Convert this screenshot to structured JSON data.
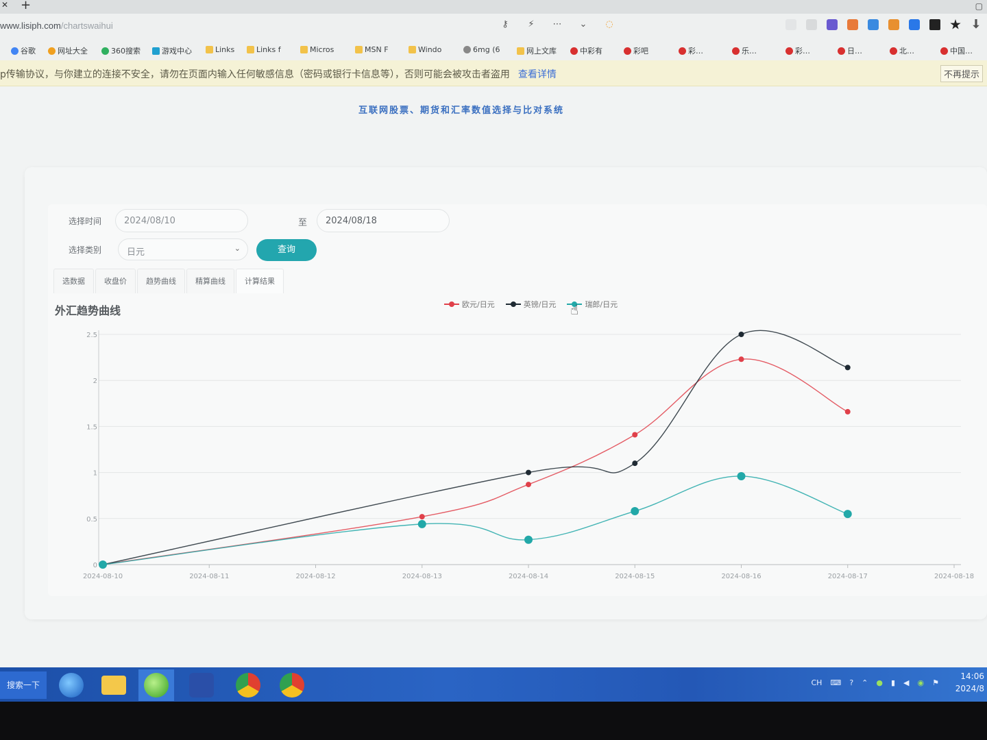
{
  "browser": {
    "url_main": "www.lisiph.com",
    "url_path": "/chartswaihui",
    "bookmarks": [
      "谷歌",
      "网址大全",
      "360搜索",
      "游戏中心",
      "Links",
      "Links f",
      "Micros",
      "MSN F",
      "Windo",
      "6mg (6",
      "网上文库",
      "中彩有",
      "彩吧",
      "彩…",
      "乐…",
      "彩…",
      "日…",
      "北…",
      "中国…"
    ],
    "warning_text": "p传输协议，与你建立的连接不安全，请勿在页面内输入任何敏感信息（密码或银行卡信息等），否则可能会被攻击者盗用",
    "warning_link": "查看详情",
    "warning_dismiss": "不再提示"
  },
  "page": {
    "site_title": "互联网股票、期货和汇率数值选择与比对系统",
    "filters": {
      "time_label": "选择时间",
      "start_date": "2024/08/10",
      "to_label": "至",
      "end_date": "2024/08/18",
      "category_label": "选择类别",
      "category_value": "日元",
      "query_button": "查询"
    },
    "tabs": [
      "选数据",
      "收盘价",
      "趋势曲线",
      "精算曲线",
      "计算结果"
    ]
  },
  "chart_data": {
    "type": "line",
    "title": "外汇趋势曲线",
    "categories": [
      "2024-08-10",
      "2024-08-11",
      "2024-08-12",
      "2024-08-13",
      "2024-08-14",
      "2024-08-15",
      "2024-08-16",
      "2024-08-17",
      "2024-08-18"
    ],
    "ylim": [
      0,
      2.5
    ],
    "yticks": [
      "0",
      "0.5",
      "1",
      "1.5",
      "2",
      "2.5"
    ],
    "legend_position": "top-center",
    "grid": true,
    "series": [
      {
        "name": "欧元/日元",
        "color": "#e0404a",
        "x_index": [
          0,
          3,
          4,
          5,
          6,
          7
        ],
        "values": [
          0,
          0.52,
          0.87,
          1.41,
          2.23,
          1.66
        ]
      },
      {
        "name": "英镑/日元",
        "color": "#1f2a33",
        "x_index": [
          0,
          4,
          5,
          6,
          7
        ],
        "values": [
          0,
          1.0,
          1.1,
          2.5,
          2.14
        ]
      },
      {
        "name": "瑞郎/日元",
        "color": "#22a8a8",
        "x_index": [
          0,
          3,
          4,
          5,
          6,
          7
        ],
        "values": [
          0,
          0.44,
          0.27,
          0.58,
          0.96,
          0.55
        ]
      }
    ]
  },
  "taskbar": {
    "start_label": "搜索一下",
    "clock_time": "14:06",
    "clock_date": "2024/8"
  }
}
